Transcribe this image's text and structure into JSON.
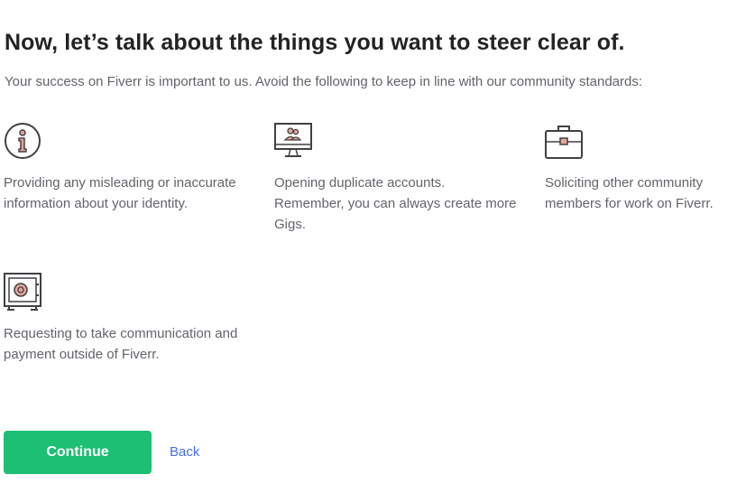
{
  "header": {
    "title": "Now, let’s talk about the things you want to steer clear of.",
    "subtitle": "Your success on Fiverr is important to us. Avoid the following to keep in line with our community standards:"
  },
  "items": [
    {
      "icon": "info-icon",
      "text": "Providing any misleading or inaccurate information about your identity."
    },
    {
      "icon": "duplicate-accounts-icon",
      "text": "Opening duplicate accounts. Remember, you can always create more Gigs."
    },
    {
      "icon": "briefcase-icon",
      "text": "Soliciting other community members for work on Fiverr."
    },
    {
      "icon": "safe-icon",
      "text": "Requesting to take communication and payment outside of Fiverr."
    }
  ],
  "actions": {
    "continue_label": "Continue",
    "back_label": "Back"
  },
  "colors": {
    "accent": "#1dbf73",
    "link": "#446ee7",
    "icon_fill": "#e8a39a",
    "icon_stroke": "#404145"
  }
}
